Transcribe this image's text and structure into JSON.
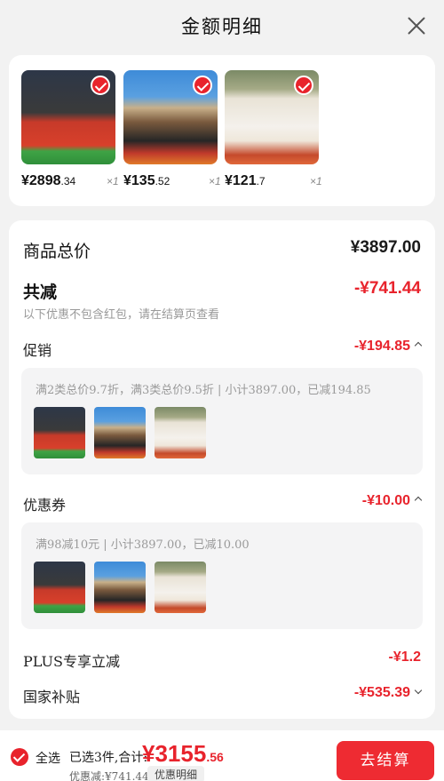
{
  "header": {
    "title": "金额明细"
  },
  "products": [
    {
      "price_int": "¥2898",
      "price_dec": ".34",
      "qty": "×1"
    },
    {
      "price_int": "¥135",
      "price_dec": ".52",
      "qty": "×1"
    },
    {
      "price_int": "¥121",
      "price_dec": ".7",
      "qty": "×1"
    }
  ],
  "summary": {
    "total_label": "商品总价",
    "total_value": "¥3897.00",
    "reduce_label": "共减",
    "reduce_value": "-¥741.44",
    "reduce_note": "以下优惠不包含红包，请在结算页查看",
    "promo": {
      "label": "促销",
      "value": "-¥194.85",
      "desc": "满2类总价9.7折，满3类总价9.5折 | 小计3897.00，已减194.85"
    },
    "coupon": {
      "label": "优惠券",
      "value": "-¥10.00",
      "desc": "满98减10元 | 小计3897.00，已减10.00"
    },
    "plus": {
      "label": "PLUS专享立减",
      "value": "-¥1.2"
    },
    "subsidy": {
      "label": "国家补贴",
      "value": "-¥535.39"
    }
  },
  "bottom": {
    "select_all": "全选",
    "total_text": "已选3件,合计:",
    "total_int": "¥3155",
    "total_dec": ".56",
    "discount": "优惠减:¥741.44",
    "detail_button": "优惠明细",
    "checkout": "去结算"
  },
  "colors": {
    "accent": "#e8232c",
    "background": "#f2f2f2"
  }
}
